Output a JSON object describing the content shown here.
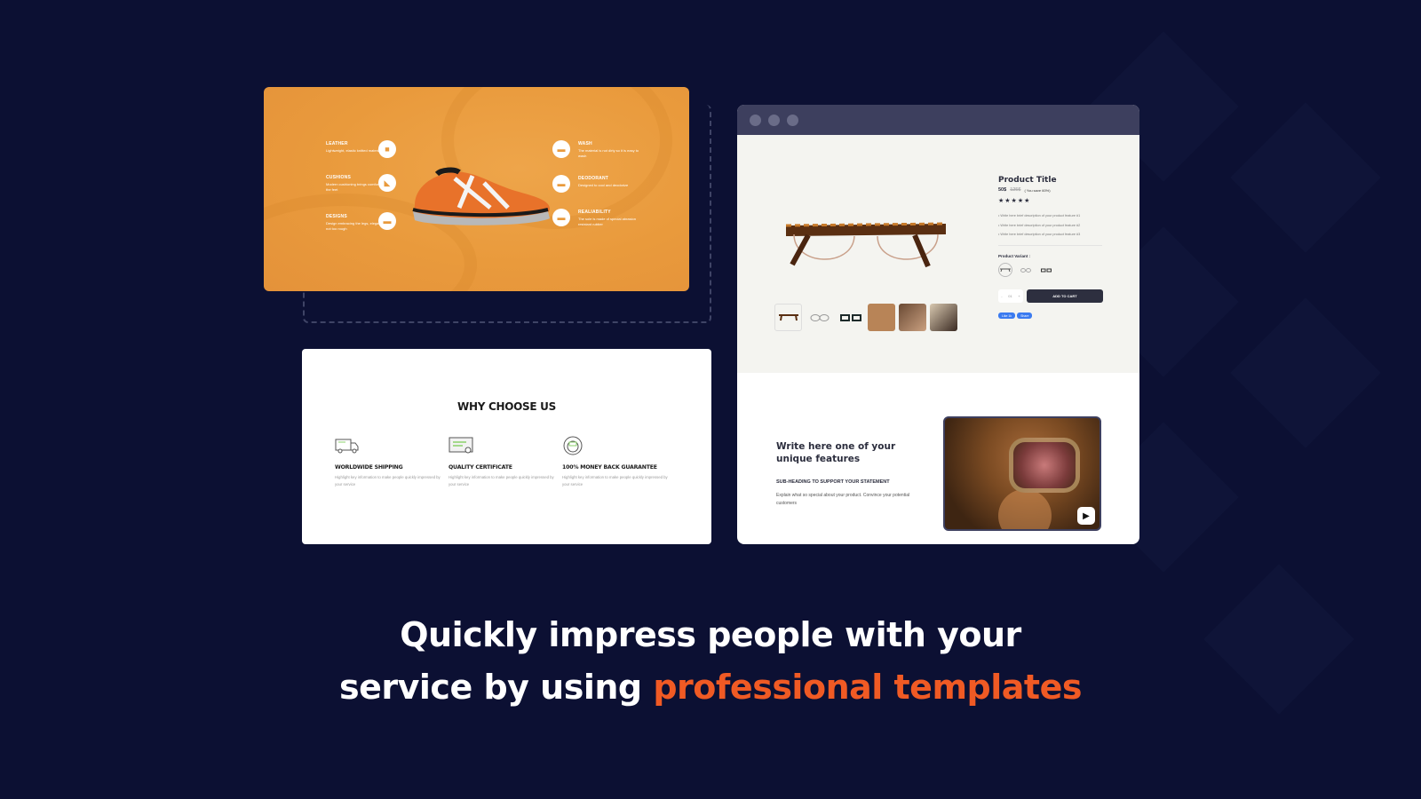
{
  "colors": {
    "background": "#0c1033",
    "accent": "#f05a24",
    "shoe_card": "#e99a3c",
    "browser_bar": "#3d3f5e",
    "button_dark": "#2d2f3f"
  },
  "shoe_card": {
    "left_features": [
      {
        "title": "LEATHER",
        "text": "Lightweight, elastic knitted material",
        "icon": "leather-icon"
      },
      {
        "title": "CUSHIONS",
        "text": "Modern cushioning brings comfort to the feet",
        "icon": "cushion-icon"
      },
      {
        "title": "DESIGNS",
        "text": "Design embracing the legs, elegant, not too rough",
        "icon": "shoe-design-icon"
      }
    ],
    "right_features": [
      {
        "title": "WASH",
        "text": "The material is not dirty so it is easy to wash",
        "icon": "wash-icon"
      },
      {
        "title": "DEODORANT",
        "text": "Designed to cool and deodorize",
        "icon": "deodorant-icon"
      },
      {
        "title": "REALIABILITY",
        "text": "The sole is made of special abrasion resistant rubber",
        "icon": "sole-icon"
      }
    ]
  },
  "why_card": {
    "title": "WHY CHOOSE US",
    "items": [
      {
        "title": "WORLDWIDE SHIPPING",
        "text": "Highlight key information to make people quickly impressed by your service",
        "icon": "truck-icon"
      },
      {
        "title": "QUALITY CERTIFICATE",
        "text": "Highlight key information to make people quickly impressed by your service",
        "icon": "certificate-icon"
      },
      {
        "title": "100% MONEY BACK GUARANTEE",
        "text": "Highlight key information to make people quickly impressed by your service",
        "icon": "money-back-icon"
      }
    ]
  },
  "product": {
    "title": "Product Title",
    "price": "50$",
    "old_price": "125$",
    "save": "( You save 60%)",
    "rating": "★★★★★",
    "bullets": [
      "Write here brief description of your product feature #1",
      "Write here brief description of your product feature #2",
      "Write here brief description of your product feature #3"
    ],
    "variant_label": "Product Variant :",
    "quantity": "01",
    "qty_minus": "-",
    "qty_plus": "+",
    "add_to_cart": "ADD TO CART",
    "like": "Like 1k",
    "share": "Share"
  },
  "feature_section": {
    "heading": "Write here one of your unique features",
    "subheading": "SUB-HEADING TO SUPPORT YOUR  STATEMENT",
    "text": "Explain what so special about your product. Convince your potential customers",
    "play_icon": "▶"
  },
  "headline": {
    "line1": "Quickly impress people with your",
    "line2_plain": "service by using ",
    "line2_accent": "professional templates"
  }
}
